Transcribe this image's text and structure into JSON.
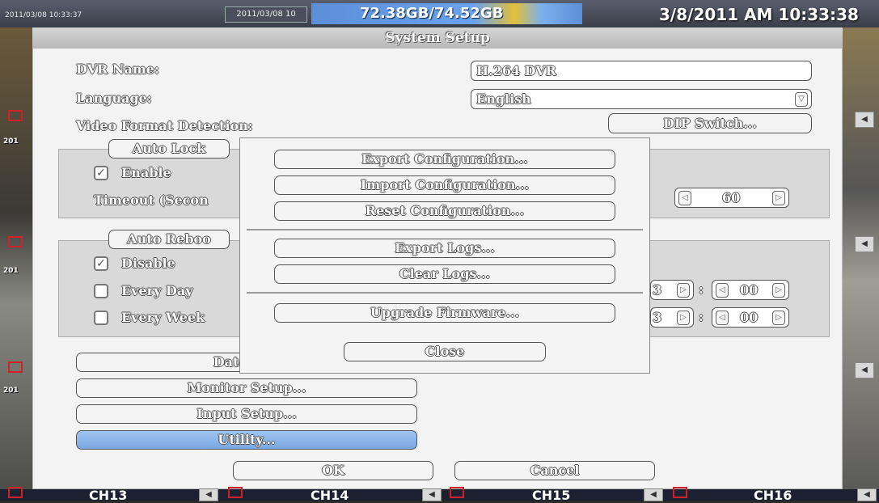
{
  "status": {
    "left_timestamp": "2011/03/08 10:33:37",
    "mid_timestamp": "2011/03/08 10",
    "hdd_usage": "72.38GB/74.52GB",
    "hdd_used_fraction": 0.971,
    "clock": "3/8/2011 AM 10:33:38"
  },
  "dialog": {
    "title": "System Setup",
    "dvr_name_label": "DVR Name:",
    "dvr_name_value": "H.264 DVR",
    "language_label": "Language:",
    "language_value": "English",
    "video_format_label": "Video Format Detection:",
    "dip_switch_button": "DIP Switch...",
    "auto_lock": {
      "group_title": "Auto Lock",
      "enable_label": "Enable",
      "enable_checked": true,
      "timeout_label": "Timeout (Secon",
      "timeout_value": "60"
    },
    "auto_reboot": {
      "group_title": "Auto Reboo",
      "disable_label": "Disable",
      "disable_checked": true,
      "every_day_label": "Every Day",
      "every_day_checked": false,
      "every_week_label": "Every Week",
      "every_week_checked": false,
      "day_hour_fragment": "3",
      "day_minute": "00",
      "week_hour_fragment": "3",
      "week_minute": "00",
      "colon": ":"
    },
    "date_time_button": "Date/Tim",
    "monitor_setup_button": "Monitor Setup...",
    "input_setup_button": "Input Setup...",
    "utility_button": "Utility...",
    "ok_button": "OK",
    "cancel_button": "Cancel"
  },
  "utility_popup": {
    "export_configuration": "Export Configuration...",
    "import_configuration": "Import Configuration...",
    "reset_configuration": "Reset Configuration...",
    "export_logs": "Export Logs...",
    "clear_logs": "Clear Logs...",
    "upgrade_firmware": "Upgrade Firmware...",
    "close": "Close"
  },
  "channels": [
    "CH13",
    "CH14",
    "CH15",
    "CH16"
  ],
  "left_cam_stamps": [
    "201",
    "201",
    "201"
  ],
  "icons": {
    "speaker": "speaker-icon",
    "record": "record-indicator-icon",
    "check": "check-icon",
    "arrow_left": "arrow-left-icon",
    "arrow_right": "arrow-right-icon",
    "dropdown": "dropdown-icon"
  },
  "colors": {
    "hdd_bar": "#5b8fd8",
    "utility_highlight": "#7aa8e0",
    "record_red": "#d0202a"
  }
}
